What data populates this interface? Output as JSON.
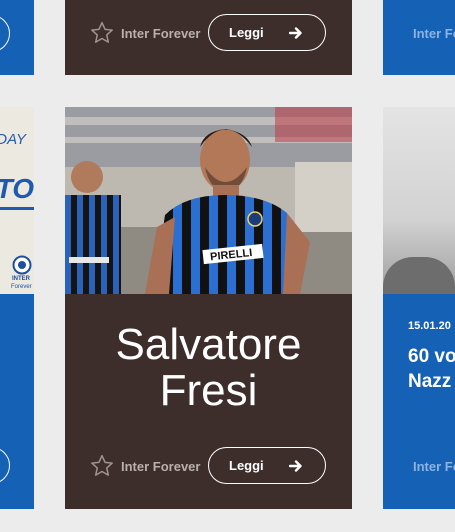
{
  "cards": {
    "top_center": {
      "brand": "Inter Forever",
      "button_label": "Leggi"
    },
    "top_right": {
      "brand": "Inter Forever"
    },
    "main": {
      "title_line1": "Salvatore",
      "title_line2": "Fresi",
      "brand": "Inter Forever",
      "button_label": "Leggi"
    },
    "left_promo": {
      "word1": "DAY",
      "word2": "TO",
      "logo_label": "INTER",
      "logo_sub": "Forever"
    },
    "right": {
      "date": "15.01.20",
      "title_line1": "60 vo",
      "title_line2": "Nazz",
      "brand": "Inter Forever"
    }
  },
  "icons": {
    "star": "star-outline-icon",
    "arrow": "arrow-right-icon"
  },
  "colors": {
    "card_brown": "#3d2e2b",
    "card_blue": "#1561b5",
    "background": "#ececec"
  }
}
